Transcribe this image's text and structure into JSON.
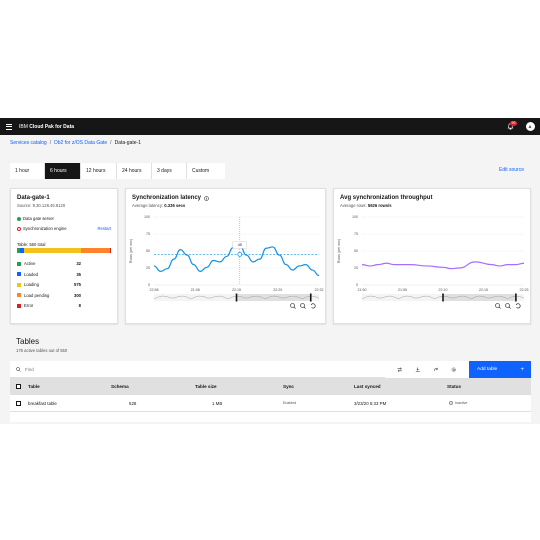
{
  "header": {
    "brand_prefix": "IBM",
    "brand_name": "Cloud Pak for Data",
    "notification_count": "99",
    "user_initial": "A"
  },
  "breadcrumb": {
    "items": [
      "Services catalog",
      "Db2 for z/OS Data Gate",
      "Data-gate-1"
    ],
    "separator": "/"
  },
  "time_tabs": [
    "1 hour",
    "6 hours",
    "12 hours",
    "24 hours",
    "3 days",
    "Custom"
  ],
  "selected_time_tab": "6 hours",
  "edit_source_label": "Edit source",
  "summary_card": {
    "title": "Data-gate-1",
    "source": "Source: 9.30.128.45.8120",
    "server_status": "Data gate server",
    "sync_engine_status": "Synchronization engine",
    "restart_label": "Restart",
    "table_total": "Table: 550 total",
    "legend": [
      {
        "label": "Active",
        "value": "32",
        "color": "#24a148"
      },
      {
        "label": "Loaded",
        "value": "35",
        "color": "#0f62fe"
      },
      {
        "label": "Loading",
        "value": "575",
        "color": "#f1c21b"
      },
      {
        "label": "Load pending",
        "value": "300",
        "color": "#ff832b"
      },
      {
        "label": "Error",
        "value": "8",
        "color": "#da1e28"
      }
    ]
  },
  "latency_card": {
    "title": "Synchronization latency",
    "subtitle_prefix": "Average latency:",
    "subtitle_value": "0.336 secs",
    "info_icon": "info-icon"
  },
  "throughput_card": {
    "title": "Avg synchronization throughput",
    "subtitle_prefix": "Average rows:",
    "subtitle_value": "5926 rows/s"
  },
  "chart_data": [
    {
      "type": "line",
      "title": "Synchronization latency",
      "ylabel": "Rows (per sec)",
      "xlabel": "",
      "ylim": [
        0,
        100
      ],
      "yticks": [
        "100",
        "75",
        "50",
        "25",
        "0"
      ],
      "xticks": [
        "22:58",
        "21:08",
        "22:15",
        "22:20",
        "22:32"
      ],
      "threshold": 45,
      "tooltip_value": "45",
      "grid": true,
      "color": "#1192e8",
      "series": [
        {
          "x": [
            0,
            0.04,
            0.08,
            0.12,
            0.16,
            0.2,
            0.24,
            0.28,
            0.32,
            0.36,
            0.4,
            0.44,
            0.48,
            0.52,
            0.56,
            0.6,
            0.64,
            0.68,
            0.72,
            0.76,
            0.8,
            0.84,
            0.88,
            0.92,
            0.96,
            1.0
          ],
          "values": [
            28,
            20,
            24,
            38,
            52,
            44,
            30,
            20,
            26,
            36,
            34,
            42,
            55,
            58,
            44,
            34,
            38,
            54,
            56,
            44,
            30,
            22,
            28,
            30,
            22,
            14
          ]
        }
      ]
    },
    {
      "type": "line",
      "title": "Avg synchronization throughput",
      "ylabel": "Rows (per sec)",
      "xlabel": "",
      "ylim": [
        0,
        100
      ],
      "yticks": [
        "100",
        "75",
        "50",
        "25",
        "0"
      ],
      "xticks": [
        "21:50",
        "21:55",
        "22:10",
        "22:15",
        "22:25"
      ],
      "grid": true,
      "color": "#a56eff",
      "series": [
        {
          "x": [
            0,
            0.05,
            0.1,
            0.15,
            0.2,
            0.3,
            0.4,
            0.5,
            0.55,
            0.6,
            0.7,
            0.8,
            0.85,
            0.9,
            0.95,
            1.0
          ],
          "values": [
            30,
            28,
            30,
            32,
            30,
            30,
            28,
            26,
            24,
            25,
            34,
            30,
            28,
            30,
            30,
            32
          ]
        }
      ]
    }
  ],
  "tables_section": {
    "title": "Tables",
    "subtitle": "175 active tables out of 550",
    "search_placeholder": "Find",
    "add_button_label": "Add table",
    "columns": [
      "Table",
      "Schema",
      "Table size",
      "Sync",
      "Last synced",
      "Status"
    ],
    "rows": [
      {
        "table": "breakfast table",
        "schema": "528",
        "size": "1 MB",
        "sync": "Enabled",
        "last_synced": "3/23/20 5:33 PM",
        "status": "Inactive"
      }
    ]
  }
}
